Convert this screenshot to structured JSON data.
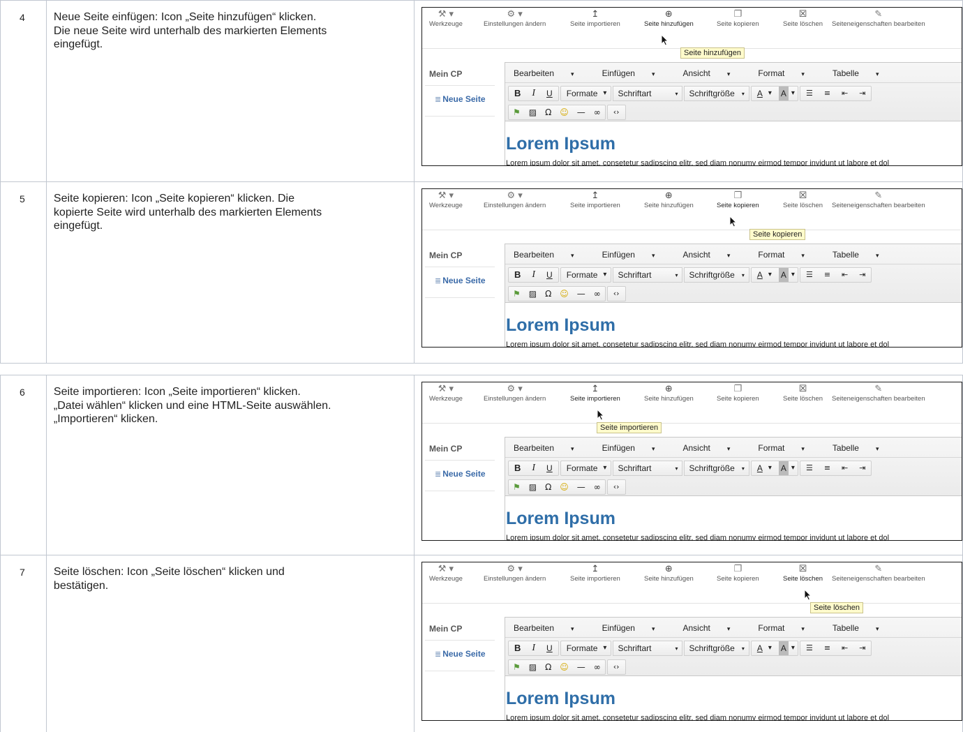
{
  "toolbar_items": [
    {
      "id": "werkzeuge",
      "label": "Werkzeuge",
      "icon": "wrench-icon"
    },
    {
      "id": "einstellungen",
      "label": "Einstellungen ändern",
      "icon": "gear-icon"
    },
    {
      "id": "importieren",
      "label": "Seite importieren",
      "icon": "upload-icon"
    },
    {
      "id": "hinzufuegen",
      "label": "Seite hinzufügen",
      "icon": "add-circle-icon"
    },
    {
      "id": "kopieren",
      "label": "Seite kopieren",
      "icon": "copy-icon"
    },
    {
      "id": "loeschen",
      "label": "Seite löschen",
      "icon": "trash-icon"
    },
    {
      "id": "eigenschaften",
      "label": "Seiteneigenschaften bearbeiten",
      "icon": "edit-icon"
    }
  ],
  "sidebar": {
    "heading": "Mein CP",
    "page_link": "Neue Seite",
    "page_icon": "document-icon"
  },
  "editor": {
    "menus": [
      "Bearbeiten",
      "Einfügen",
      "Ansicht",
      "Format",
      "Tabelle"
    ],
    "format_buttons": [
      "B",
      "I",
      "U"
    ],
    "formats_label": "Formate",
    "font_label": "Schriftart",
    "size_label": "Schriftgröße",
    "text_color_label": "A",
    "bg_color_label": "A",
    "heading": "Lorem Ipsum",
    "body": "Lorem ipsum dolor sit amet, consetetur sadipscing elitr, sed diam nonumy eirmod tempor invidunt ut labore et dol"
  },
  "steps": [
    {
      "number": "4",
      "lines": [
        "Neue Seite einfügen: Icon „Seite hinzufügen“ klicken.",
        "Die neue Seite wird unterhalb des markierten Elements",
        "eingefügt."
      ],
      "active": "hinzufuegen",
      "tooltip": "Seite hinzufügen"
    },
    {
      "number": "5",
      "lines": [
        "Seite kopieren: Icon „Seite kopieren“ klicken. Die",
        "kopierte Seite wird unterhalb des markierten Elements",
        "eingefügt."
      ],
      "active": "kopieren",
      "tooltip": "Seite kopieren"
    },
    {
      "number": "6",
      "lines": [
        "Seite importieren: Icon „Seite importieren“ klicken.",
        "„Datei wählen“ klicken und eine HTML-Seite auswählen.",
        "„Importieren“ klicken."
      ],
      "active": "importieren",
      "tooltip": "Seite importieren"
    },
    {
      "number": "7",
      "lines": [
        "Seite löschen: Icon „Seite löschen“ klicken und",
        "bestätigen."
      ],
      "active": "loeschen",
      "tooltip": "Seite löschen"
    }
  ]
}
